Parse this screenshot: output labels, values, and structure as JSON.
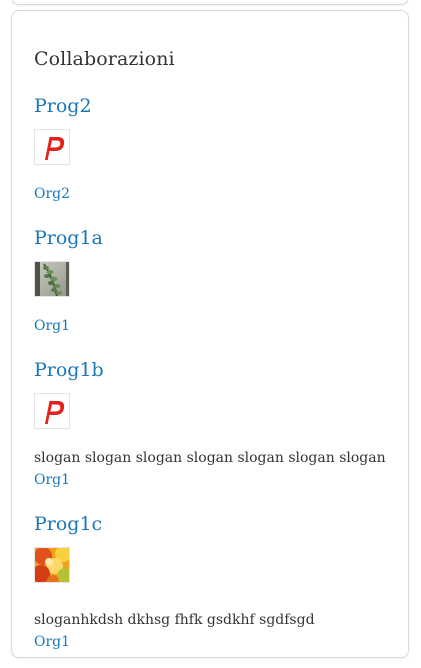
{
  "section": {
    "title": "Collaborazioni"
  },
  "items": [
    {
      "name": "Prog2",
      "image": "p-logo-icon",
      "slogan": "",
      "org": "Org2"
    },
    {
      "name": "Prog1a",
      "image": "plant-photo",
      "slogan": "",
      "org": "Org1"
    },
    {
      "name": "Prog1b",
      "image": "p-logo-icon",
      "slogan": "slogan slogan slogan slogan slogan slogan slogan",
      "org": "Org1"
    },
    {
      "name": "Prog1c",
      "image": "autumn-leaves-photo",
      "slogan": "sloganhkdsh dkhsg fhfk gsdkhf sgdfsgd",
      "org": "Org1"
    }
  ],
  "colors": {
    "link": "#1a76b7",
    "text": "#333333",
    "logo_red": "#e3231b"
  }
}
